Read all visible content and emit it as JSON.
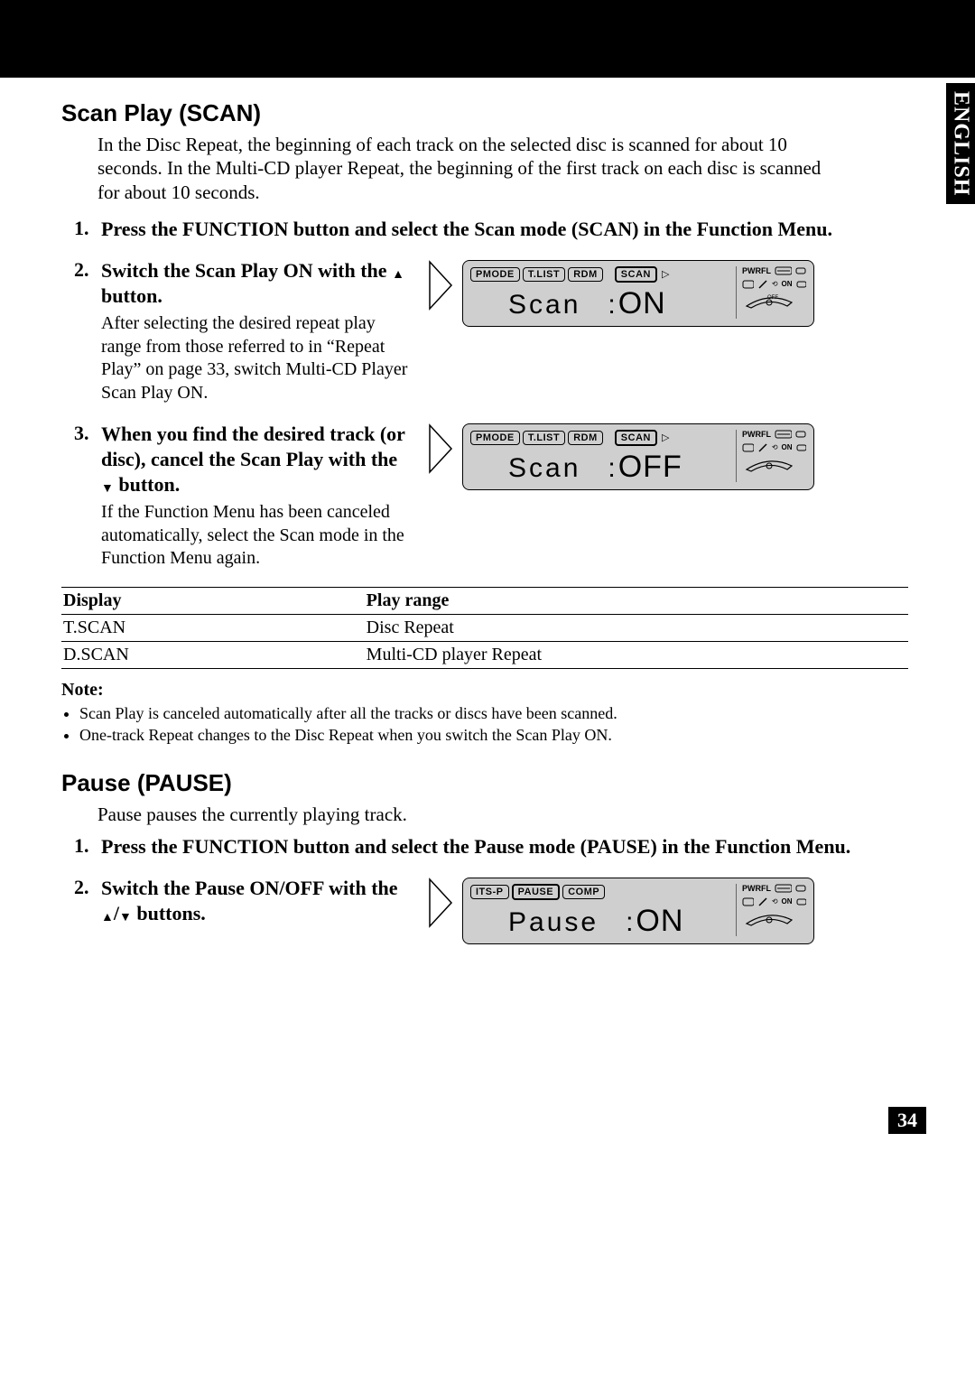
{
  "side_tab": "ENGLISH",
  "section1": {
    "title": "Scan Play (SCAN)",
    "intro": "In the Disc Repeat, the beginning of each track on the selected disc is scanned for about 10 seconds. In the Multi-CD player Repeat, the beginning of the first track on each disc is scanned for about 10 seconds.",
    "step1": "Press the FUNCTION button and select the Scan mode (SCAN) in the Function Menu.",
    "step2_head_a": "Switch the Scan Play ON with the",
    "step2_head_b": " button.",
    "step2_body": "After selecting the desired repeat play range from those referred to in “Repeat Play” on page 33, switch Multi-CD Player Scan Play ON.",
    "step3_head_a": "When you find the desired track (or disc), cancel the Scan Play with the ",
    "step3_head_b": " button.",
    "step3_body": "If the Function Menu has been canceled automatically, select the Scan mode in the Function Menu again."
  },
  "lcd": {
    "tabs_scan": [
      "PMODE",
      "T.LIST",
      "RDM"
    ],
    "tab_sel": "SCAN",
    "tabs_pause": [
      "ITS-P",
      "PAUSE",
      "COMP"
    ],
    "label_scan": "Scan",
    "label_pause": "Pause",
    "on": "ON",
    "off": "OFF",
    "pwrfl": "PWRFL",
    "on_small": "ON",
    "off_small": "OFF"
  },
  "table": {
    "h1": "Display",
    "h2": "Play range",
    "rows": [
      {
        "c1": "T.SCAN",
        "c2": "Disc Repeat"
      },
      {
        "c1": "D.SCAN",
        "c2": "Multi-CD player Repeat"
      }
    ]
  },
  "notes": {
    "head": "Note:",
    "items": [
      "Scan Play is canceled automatically after all the tracks or discs have been scanned.",
      "One-track Repeat changes to the Disc Repeat when you switch the Scan Play ON."
    ]
  },
  "section2": {
    "title": "Pause (PAUSE)",
    "intro": "Pause pauses the currently playing track.",
    "step1": "Press the FUNCTION button and select the Pause mode (PAUSE) in the Function Menu.",
    "step2_head_a": "Switch the Pause ON/OFF with the ",
    "step2_head_b": " buttons."
  },
  "page_number": "34"
}
